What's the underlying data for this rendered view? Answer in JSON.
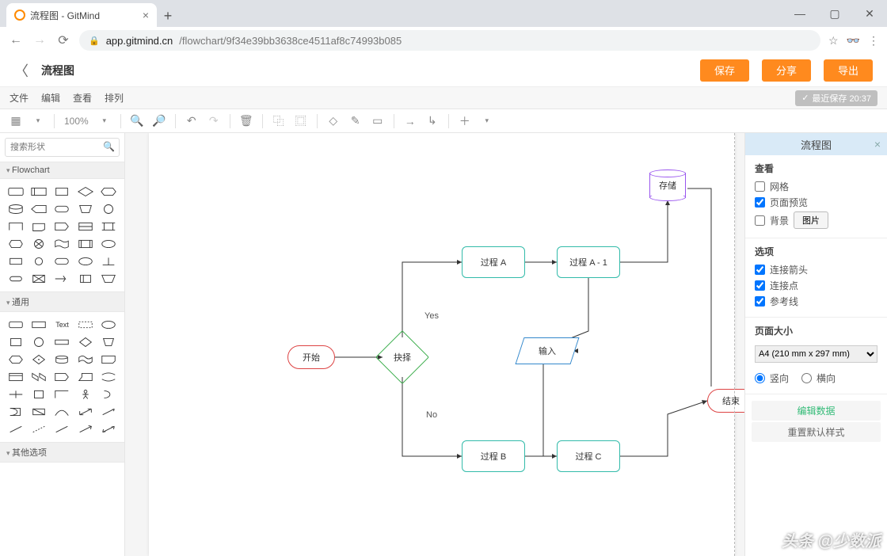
{
  "browser": {
    "tab_title": "流程图 - GitMind",
    "url_host": "app.gitmind.cn",
    "url_path": "/flowchart/9f34e39bb3638ce4511af8c74993b085",
    "win_min": "—",
    "win_max": "▢",
    "win_close": "✕"
  },
  "header": {
    "title": "流程图",
    "save": "保存",
    "share": "分享",
    "export": "导出"
  },
  "menu": {
    "file": "文件",
    "edit": "编辑",
    "view": "查看",
    "arrange": "排列",
    "save_status": "最近保存 20:37"
  },
  "toolbar": {
    "zoom": "100%"
  },
  "sidebar": {
    "search_placeholder": "搜索形状",
    "section_flowchart": "Flowchart",
    "section_general": "通用",
    "section_other": "其他选项",
    "text_label": "Text"
  },
  "right": {
    "tab": "流程图",
    "view_head": "查看",
    "grid": "网格",
    "page_preview": "页面预览",
    "background": "背景",
    "btn_image": "图片",
    "opts_head": "选项",
    "connect_arrow": "连接箭头",
    "connect_point": "连接点",
    "guide": "参考线",
    "pagesize_head": "页面大小",
    "page_size": "A4 (210 mm x 297 mm)",
    "portrait": "竖向",
    "landscape": "横向",
    "edit_data": "编辑数据",
    "reset_style": "重置默认样式"
  },
  "flow": {
    "start": "开始",
    "decision": "抉择",
    "yes": "Yes",
    "no": "No",
    "procA": "过程 A",
    "procA1": "过程 A - 1",
    "procB": "过程 B",
    "procC": "过程 C",
    "input": "输入",
    "storage": "存储",
    "end": "结束"
  },
  "watermark": "头条 @少数派"
}
